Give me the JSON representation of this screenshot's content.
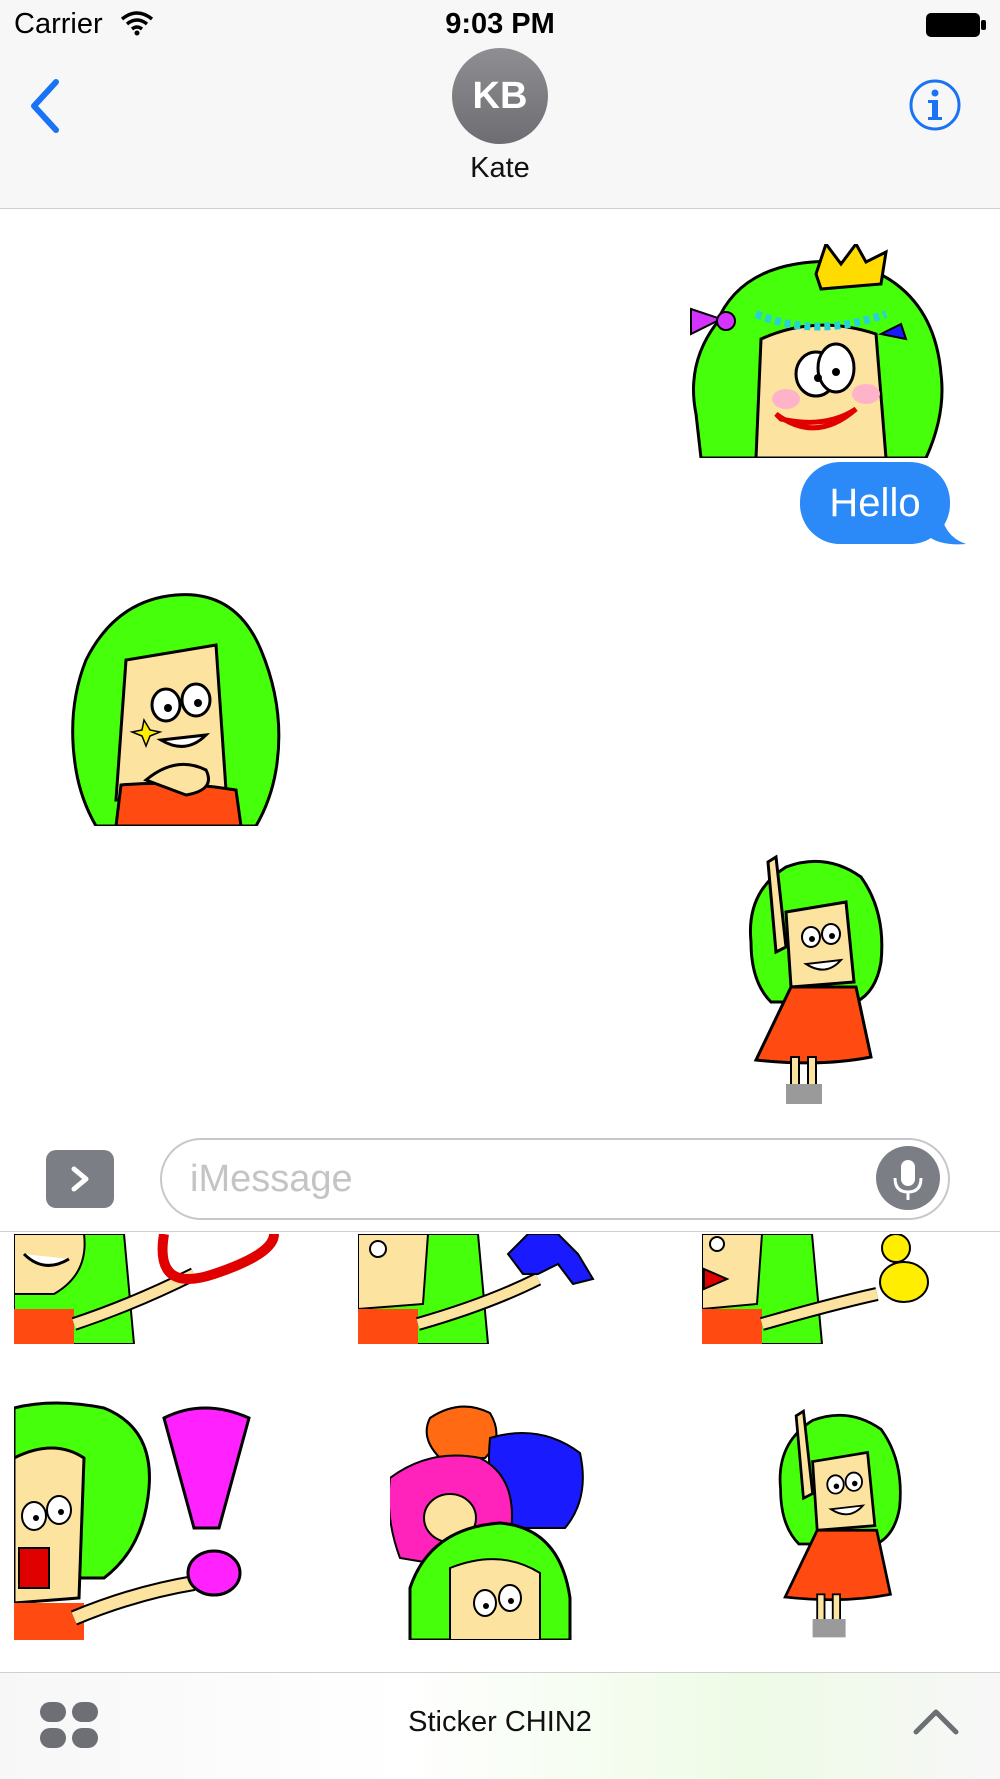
{
  "status_bar": {
    "carrier": "Carrier",
    "time": "9:03 PM",
    "icons": [
      "wifi-icon",
      "battery-icon"
    ]
  },
  "header": {
    "back_icon": "chevron-left-icon",
    "avatar_initials": "KB",
    "contact_name": "Kate",
    "info_icon": "info-icon"
  },
  "conversation": {
    "messages": [
      {
        "type": "sticker",
        "side": "right",
        "description_icon": "princess-sticker"
      },
      {
        "type": "text",
        "side": "right",
        "text": "Hello"
      },
      {
        "type": "sticker",
        "side": "left",
        "description_icon": "thinking-girl-sticker"
      },
      {
        "type": "sticker",
        "side": "right",
        "description_icon": "waving-girl-sticker"
      }
    ]
  },
  "composer": {
    "apps_icon": "chevron-right-icon",
    "placeholder": "iMessage",
    "mic_icon": "microphone-icon"
  },
  "drawer": {
    "title": "Sticker CHIN2",
    "grid_icon": "app-grid-icon",
    "expand_icon": "chevron-up-icon",
    "colors": {
      "hair": "#46ff0a",
      "dress": "#ff4a12",
      "skin": "#fce3a0"
    }
  }
}
